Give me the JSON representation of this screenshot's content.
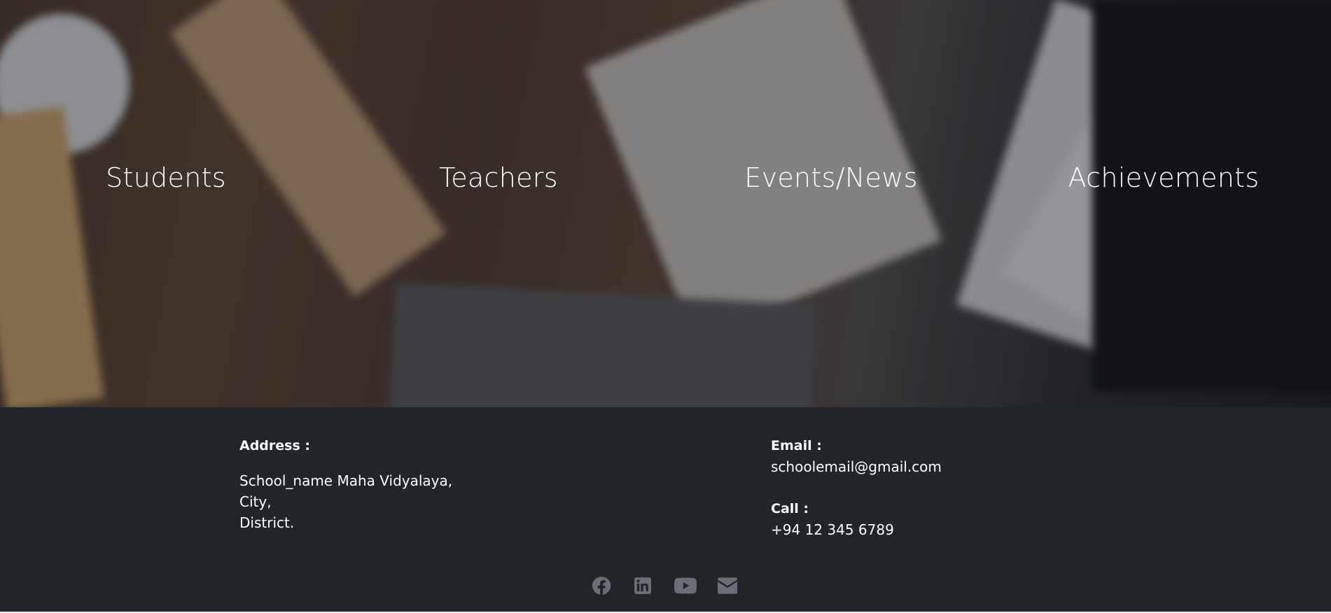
{
  "nav": {
    "items": [
      {
        "label": "Students"
      },
      {
        "label": "Teachers"
      },
      {
        "label": "Events/News"
      },
      {
        "label": "Achievements"
      }
    ]
  },
  "footer": {
    "address_label": "Address :",
    "address_lines": [
      "School_name Maha Vidyalaya,",
      "City,",
      "District."
    ],
    "email_label": "Email :",
    "email_value": "schoolemail@gmail.com",
    "call_label": "Call :",
    "call_value": "+94 12 345 6789",
    "social_icons": [
      "facebook-icon",
      "linkedin-icon",
      "youtube-icon",
      "envelope-icon"
    ]
  },
  "colors": {
    "footer_bg": "#212429",
    "text": "#ffffff",
    "icon": "#6b6f75"
  }
}
